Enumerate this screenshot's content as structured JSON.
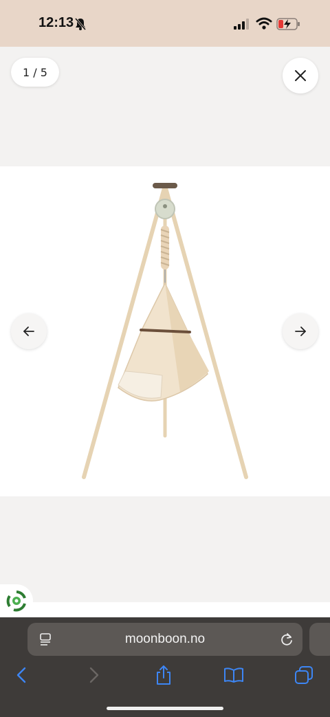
{
  "status_bar": {
    "time": "12:13"
  },
  "gallery": {
    "counter": "1 / 5",
    "image_description_icon": "cradle-on-tripod-stand",
    "close_icon": "close-icon",
    "prev_icon": "arrow-left-icon",
    "next_icon": "arrow-right-icon"
  },
  "browser": {
    "url": "moonboon.no"
  },
  "colors": {
    "status_bar_bg": "#e8d6c8",
    "browser_bg": "#3e3b39",
    "accent_blue": "#3d86f5"
  }
}
